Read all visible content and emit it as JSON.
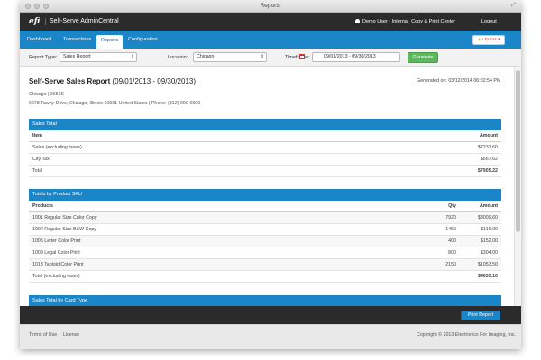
{
  "window": {
    "title": "Reports"
  },
  "appbar": {
    "logo": "efi",
    "app_name": "Self-Serve AdminCentral",
    "user": "Demo User - Internal_Copy & Print Center",
    "logout": "Logout"
  },
  "nav": {
    "tabs": [
      {
        "label": "Dashboard"
      },
      {
        "label": "Transactions"
      },
      {
        "label": "Reports",
        "active": true
      },
      {
        "label": "Configuration"
      }
    ],
    "errors_label": "! Errors"
  },
  "filters": {
    "report_type_label": "Report Type:",
    "report_type_value": "Sales Report",
    "location_label": "Location:",
    "location_value": "Chicago",
    "timeframe_label": "Timeframe:",
    "timeframe_value": "09/01/2013 - 09/30/2013",
    "generate_label": "Generate"
  },
  "report": {
    "title_bold": "Self-Serve Sales Report",
    "title_range": " (09/01/2013 - 09/30/2013)",
    "generated": "Generated on: 03/12/2014 06:02:54 PM",
    "address_line1": "Chicago | 2653S",
    "address_line2": "6978 Tawny Drive, Chicago, Illinois 60601 United States | Phone: (312) 000-0000"
  },
  "sales_total": {
    "header": "Sales Total",
    "col_item": "Item",
    "col_amount": "Amount",
    "rows": [
      {
        "item": "Sales (excluding taxes)",
        "amount": "$7237.60"
      },
      {
        "item": "City Tax",
        "amount": "$667.62"
      }
    ],
    "total_label": "Total",
    "total_amount": "$7905.22"
  },
  "by_sku": {
    "header": "Totals by Product SKU",
    "col_products": "Products",
    "col_qty": "Qty",
    "col_amount": "Amount",
    "rows": [
      {
        "product": "1001 Regular Size Color Copy",
        "qty": "7920",
        "amount": "$3009.60"
      },
      {
        "product": "1002 Regular Size B&W Copy",
        "qty": "1450",
        "amount": "$116.00"
      },
      {
        "product": "1005 Letter Color Print",
        "qty": "400",
        "amount": "$152.00"
      },
      {
        "product": "1009 Legal Color Print",
        "qty": "800",
        "amount": "$304.00"
      },
      {
        "product": "1013 Tabloid Color Print",
        "qty": "2150",
        "amount": "$1053.50"
      }
    ],
    "total_label": "Total (excluding taxes)",
    "total_amount": "$4635.10"
  },
  "by_card": {
    "header": "Sales Total by Card Type"
  },
  "footer": {
    "print_label": "Print Report",
    "terms": "Terms of Use",
    "license": "License",
    "copyright": "Copyright © 2013 Electronics For Imaging, Inc."
  }
}
